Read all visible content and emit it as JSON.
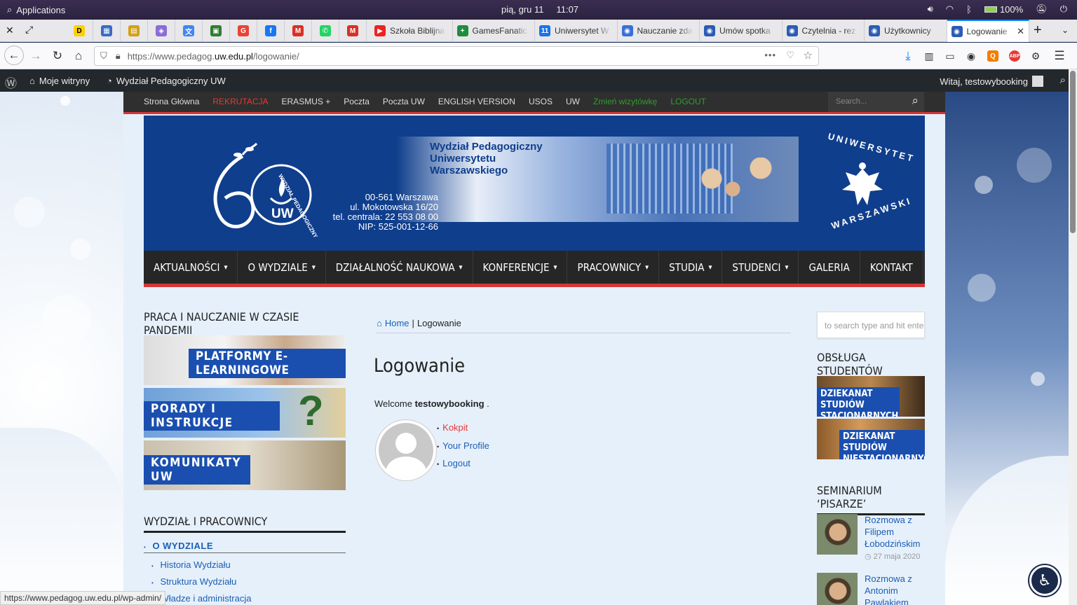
{
  "gnome": {
    "apps": "Applications",
    "date": "pią, gru 11",
    "time": "11:07",
    "battery": "100%"
  },
  "tabs": [
    {
      "label": "Szkoła Biblijna",
      "color": "#e22",
      "glyph": "▶"
    },
    {
      "label": "GamesFanatic",
      "color": "#1e8e3e",
      "glyph": "+"
    },
    {
      "label": "Uniwersytet W",
      "color": "#1a73e8",
      "glyph": "11"
    },
    {
      "label": "Nauczanie zda",
      "color": "#3a6fd8",
      "glyph": "◉"
    },
    {
      "label": "Umów spotka",
      "color": "#2b5cb5",
      "glyph": "◉"
    },
    {
      "label": "Czytelnia - rez",
      "color": "#2b5cb5",
      "glyph": "◉"
    },
    {
      "label": "Użytkownicy",
      "color": "#2b5cb5",
      "glyph": "◉"
    },
    {
      "label": "Logowanie",
      "color": "#2b5cb5",
      "glyph": "◉"
    }
  ],
  "pinned": [
    {
      "glyph": "D",
      "color": "#ffd000"
    },
    {
      "glyph": "▦",
      "color": "#3b6bc8"
    },
    {
      "glyph": "▤",
      "color": "#d4a017"
    },
    {
      "glyph": "◈",
      "color": "#8a6cd8"
    },
    {
      "glyph": "文",
      "color": "#4285f4"
    },
    {
      "glyph": "▣",
      "color": "#2e7d32"
    },
    {
      "glyph": "G",
      "color": "#ea4335"
    },
    {
      "glyph": "f",
      "color": "#1877f2"
    },
    {
      "glyph": "M",
      "color": "#d93025"
    },
    {
      "glyph": "✆",
      "color": "#25d366"
    },
    {
      "glyph": "M",
      "color": "#d93025"
    }
  ],
  "nav": {
    "url_prefix": "https://www.pedagog.",
    "url_domain": "uw.edu.pl",
    "url_path": "/logowanie/"
  },
  "wpbar": {
    "my_sites": "Moje witryny",
    "site": "Wydział Pedagogiczny UW",
    "greeting": "Witaj, testowybooking"
  },
  "topnav": {
    "items": [
      {
        "label": "Strona Główna",
        "color": "#ddd"
      },
      {
        "label": "REKRUTACJA",
        "color": "#e53935"
      },
      {
        "label": "ERASMUS +",
        "color": "#ddd"
      },
      {
        "label": "Poczta",
        "color": "#ddd"
      },
      {
        "label": "Poczta UW",
        "color": "#ddd"
      },
      {
        "label": "ENGLISH VERSION",
        "color": "#ddd"
      },
      {
        "label": "USOS",
        "color": "#ddd"
      },
      {
        "label": "UW",
        "color": "#ddd"
      },
      {
        "label": "Zmień wizytówkę",
        "color": "#2e9e2e"
      },
      {
        "label": "LOGOUT",
        "color": "#2e9e2e"
      }
    ],
    "search_placeholder": "Search..."
  },
  "banner": {
    "line1": "Wydział Pedagogiczny",
    "line2": "Uniwersytetu",
    "line3": "Warszawskiego",
    "addr1": "00-561 Warszawa",
    "addr2": "ul. Mokotowska 16/20",
    "addr3": "tel. centrala: 22 553 08 00",
    "addr4": "NIP: 525-001-12-66",
    "logo_text": "WYDZIAŁ PEDAGOGICZNY",
    "logo_uw": "UW",
    "seal_top": "UNIWERSYTET",
    "seal_bottom": "WARSZAWSKI"
  },
  "mainnav": [
    "AKTUALNOŚCI",
    "O WYDZIALE",
    "DZIAŁALNOŚĆ NAUKOWA",
    "KONFERENCJE",
    "PRACOWNICY",
    "STUDIA",
    "STUDENCI",
    "GALERIA",
    "KONTAKT"
  ],
  "mainnav_dropdown": [
    true,
    true,
    true,
    true,
    true,
    true,
    true,
    false,
    false
  ],
  "left": {
    "pandemic_title": "PRACA I NAUCZANIE W CZASIE PANDEMII",
    "promo1": "PLATFORMY E-LEARNINGOWE",
    "promo2": "PORADY I INSTRUKCJE",
    "promo3": "KOMUNIKATY UW",
    "faculty_title": "WYDZIAŁ I PRACOWNICY",
    "faculty_main": "O WYDZIALE",
    "faculty_links": [
      "Historia Wydziału",
      "Struktura Wydziału",
      "Władze i administracja"
    ]
  },
  "main": {
    "breadcrumb_home": "Home",
    "breadcrumb_sep": "|",
    "breadcrumb_current": "Logowanie",
    "title": "Logowanie",
    "welcome": "Welcome",
    "username": "testowybooking",
    "welcome_end": ".",
    "links": [
      {
        "label": "Kokpit",
        "color": "#e53935"
      },
      {
        "label": "Your Profile",
        "color": "#1a5fb4"
      },
      {
        "label": "Logout",
        "color": "#1a5fb4"
      }
    ]
  },
  "right": {
    "search_placeholder": "to search type and hit enter",
    "students_title": "OBSŁUGA STUDENTÓW",
    "promo1": "DZIEKANAT STUDIÓW STACJONARNYCH",
    "promo2": "DZIEKANAT STUDIÓW NIESTACJONARNYCH",
    "seminar_title": "SEMINARIUM ‘PISARZE’",
    "posts": [
      {
        "title": "Rozmowa z Filipem Łobodzińskim",
        "date": "27 maja 2020"
      },
      {
        "title": "Rozmowa z Antonim Pawlakiem",
        "date": ""
      }
    ]
  },
  "statusbar": "https://www.pedagog.uw.edu.pl/wp-admin/"
}
